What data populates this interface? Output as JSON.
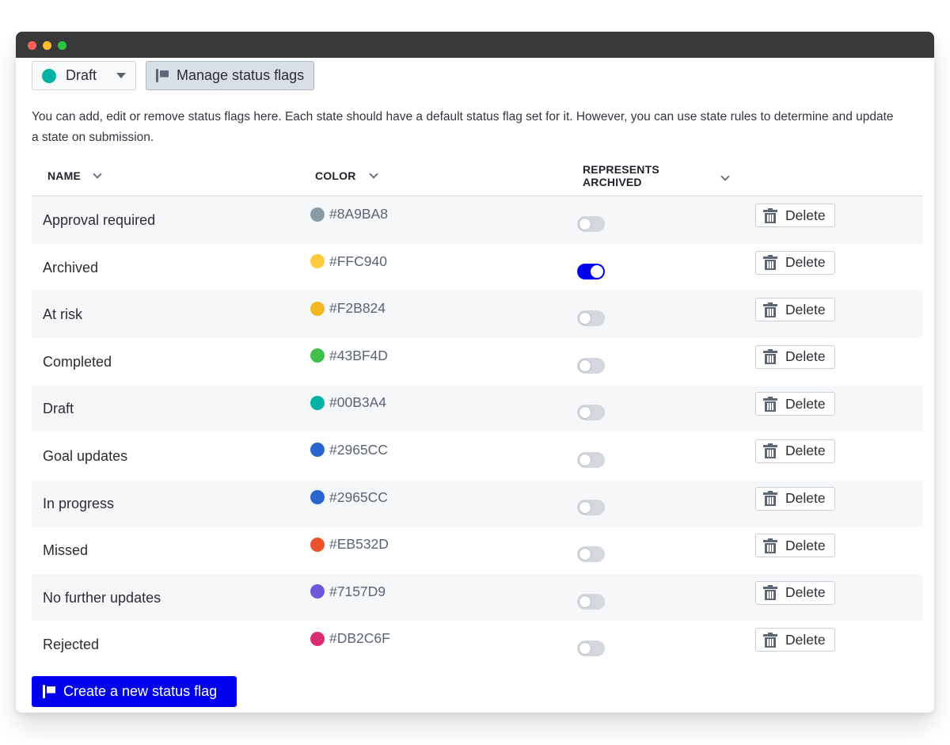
{
  "window": {
    "controls": [
      "close",
      "minimize",
      "maximize"
    ]
  },
  "toolbar": {
    "state_select": {
      "value": "Draft",
      "color": "#00B3A4",
      "icon": "caret-down-icon"
    },
    "manage_button": {
      "label": "Manage status flags",
      "icon": "flag-icon"
    }
  },
  "description": "You can add, edit or remove status flags here. Each state should have a default status flag set for it. However, you can use state rules to determine and update a state on submission.",
  "table": {
    "columns": [
      {
        "label": "NAME",
        "icon": "chevron-down-icon"
      },
      {
        "label": "COLOR",
        "icon": "chevron-down-icon"
      },
      {
        "label": "REPRESENTS ARCHIVED",
        "icon": "chevron-down-icon"
      }
    ],
    "delete_label": "Delete",
    "rows": [
      {
        "name": "Approval required",
        "color": "#8A9BA8",
        "archived": false
      },
      {
        "name": "Archived",
        "color": "#FFC940",
        "archived": true
      },
      {
        "name": "At risk",
        "color": "#F2B824",
        "archived": false
      },
      {
        "name": "Completed",
        "color": "#43BF4D",
        "archived": false
      },
      {
        "name": "Draft",
        "color": "#00B3A4",
        "archived": false
      },
      {
        "name": "Goal updates",
        "color": "#2965CC",
        "archived": false
      },
      {
        "name": "In progress",
        "color": "#2965CC",
        "archived": false
      },
      {
        "name": "Missed",
        "color": "#EB532D",
        "archived": false
      },
      {
        "name": "No further updates",
        "color": "#7157D9",
        "archived": false
      },
      {
        "name": "Rejected",
        "color": "#DB2C6F",
        "archived": false
      }
    ]
  },
  "create_button": {
    "label": "Create a new status flag",
    "icon": "flag-icon"
  },
  "theme": {
    "accent": "#0000EE",
    "titlebar": "#37383A"
  }
}
